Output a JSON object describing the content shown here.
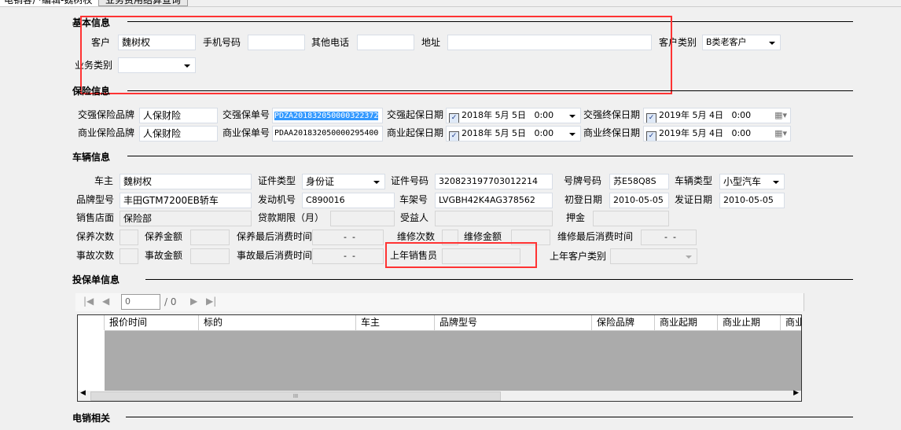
{
  "tabs": [
    {
      "label": "电销客户编辑-魏树权",
      "active": true
    },
    {
      "label": "业务费用结算查询",
      "active": false
    }
  ],
  "basic": {
    "title": "基本信息",
    "customer_label": "客户",
    "customer": "魏树权",
    "mobile_label": "手机号码",
    "mobile": "",
    "other_phone_label": "其他电话",
    "other_phone": "",
    "address_label": "地址",
    "address": "",
    "category_label": "客户类别",
    "category": "B类老客户",
    "biz_type_label": "业务类别",
    "biz_type": ""
  },
  "insurance": {
    "title": "保险信息",
    "ci_brand_label": "交强保险品牌",
    "ci_brand": "人保财险",
    "ci_policy_label": "交强保单号",
    "ci_policy": "PDZA201832050000322372",
    "ci_start_label": "交强起保日期",
    "ci_start": "2018年 5月 5日   0:00",
    "ci_end_label": "交强终保日期",
    "ci_end": "2019年 5月 4日   0:00",
    "bi_brand_label": "商业保险品牌",
    "bi_brand": "人保财险",
    "bi_policy_label": "商业保单号",
    "bi_policy": "PDAA201832050000295400",
    "bi_start_label": "商业起保日期",
    "bi_start": "2018年 5月 5日   0:00",
    "bi_end_label": "商业终保日期",
    "bi_end": "2019年 5月 4日   0:00"
  },
  "vehicle": {
    "title": "车辆信息",
    "owner_label": "车主",
    "owner": "魏树权",
    "id_type_label": "证件类型",
    "id_type": "身份证",
    "id_no_label": "证件号码",
    "id_no": "320823197703012214",
    "plate_label": "号牌号码",
    "plate": "苏E58Q8S",
    "veh_type_label": "车辆类型",
    "veh_type": "小型汽车",
    "model_label": "品牌型号",
    "model": "丰田GTM7200EB轿车",
    "engine_label": "发动机号",
    "engine": "C890016",
    "vin_label": "车架号",
    "vin": "LVGBH42K4AG378562",
    "reg_date_label": "初登日期",
    "reg_date": "2010-05-05",
    "issue_date_label": "发证日期",
    "issue_date": "2010-05-05",
    "store_label": "销售店面",
    "store": "保险部",
    "loan_label": "贷款期限（月）",
    "beneficiary_label": "受益人",
    "deposit_label": "押金",
    "maint_count_label": "保养次数",
    "maint_amount_label": "保养金额",
    "maint_last_label": "保养最后消费时间",
    "maint_last": "-  -",
    "repair_count_label": "维修次数",
    "repair_amount_label": "维修金额",
    "repair_last_label": "维修最后消费时间",
    "repair_last": "-  -",
    "acc_count_label": "事故次数",
    "acc_amount_label": "事故金额",
    "acc_last_label": "事故最后消费时间",
    "acc_last": "-  -",
    "last_sales_label": "上年销售员",
    "last_cat_label": "上年客户类别"
  },
  "quotes": {
    "title": "投保单信息",
    "page": "0",
    "total": "/ 0",
    "columns": [
      "报价时间",
      "标的",
      "车主",
      "品牌型号",
      "保险品牌",
      "商业起期",
      "商业止期",
      "商业"
    ],
    "scroll_glyph": "III"
  },
  "telesales": {
    "title": "电销相关"
  },
  "colors": {
    "highlight": "#3399ff",
    "annotation": "#ff3333"
  }
}
